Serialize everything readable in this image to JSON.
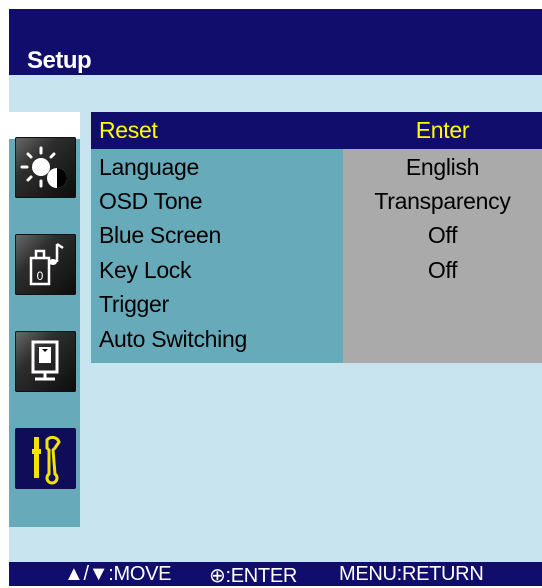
{
  "header": {
    "title": "Setup"
  },
  "sidebar": {
    "icons": [
      {
        "name": "brightness-contrast-icon"
      },
      {
        "name": "sound-icon"
      },
      {
        "name": "display-icon"
      },
      {
        "name": "setup-tools-icon",
        "active": true
      }
    ]
  },
  "menu": {
    "items": [
      {
        "label": "Reset",
        "value": "Enter",
        "selected": true
      },
      {
        "label": "Language",
        "value": "English"
      },
      {
        "label": "OSD Tone",
        "value": "Transparency"
      },
      {
        "label": "Blue Screen",
        "value": "Off"
      },
      {
        "label": "Key Lock",
        "value": "Off"
      },
      {
        "label": "Trigger",
        "value": ""
      },
      {
        "label": "Auto Switching",
        "value": ""
      }
    ]
  },
  "footer": {
    "move": "▲/▼:MOVE",
    "enter": "⊕:ENTER",
    "return": "MENU:RETURN"
  },
  "colors": {
    "header": "#110d6c",
    "selected_text": "#ffff00",
    "menu_bg": "#67abbb",
    "value_bg": "#aaaaaa",
    "light_bg": "#c8e4ee"
  }
}
